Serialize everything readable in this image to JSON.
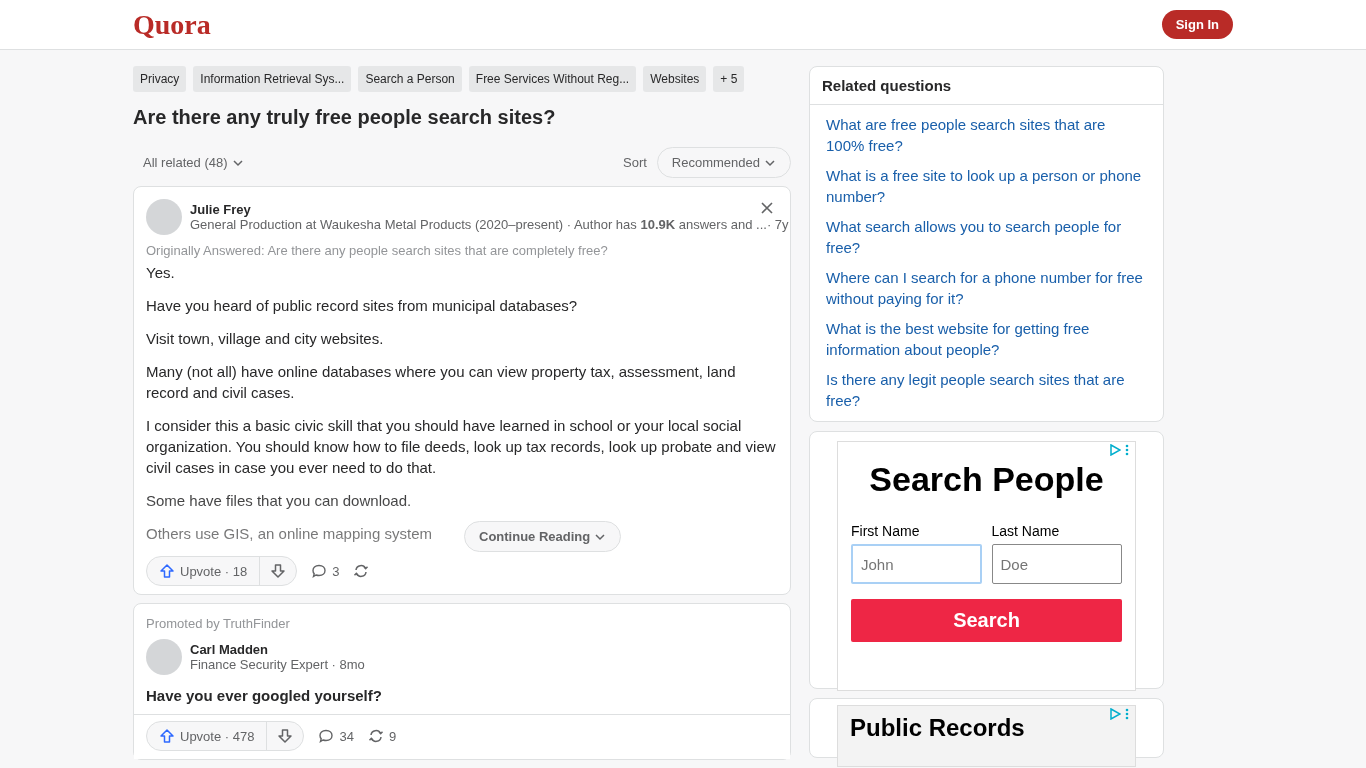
{
  "header": {
    "logo": "Quora",
    "sign_in": "Sign In"
  },
  "topics": [
    {
      "label": "Privacy"
    },
    {
      "label": "Information Retrieval Sys..."
    },
    {
      "label": "Search a Person"
    },
    {
      "label": "Free Services Without Reg..."
    },
    {
      "label": "Websites"
    }
  ],
  "more_topics": "+ 5",
  "question": "Are there any truly free people search sites?",
  "filter": {
    "label": "All related (48)",
    "sort_label": "Sort",
    "sort_value": "Recommended"
  },
  "answer": {
    "author": "Julie Frey",
    "meta": "General Production at Waukesha Metal Products (2020–present) · Author has **10.9K** answers and ...",
    "age": "· 7y",
    "original": "Originally Answered: Are there any people search sites that are completely free?",
    "paragraphs": [
      "Yes.",
      "Have you heard of public record sites from municipal databases?",
      "Visit town, village and city websites.",
      "Many (not all) have online databases where you can view property tax, assessment, land record and civil cases.",
      "I consider this a basic civic skill that you should have learned in school or your local social organization. You should know how to file deeds, look up tax records, look up probate and view civil cases in case you ever need to do that.",
      "Some have files that you can download.",
      "Others use GIS, an online mapping system"
    ],
    "continue": "Continue Reading",
    "upvote": "Upvote · 18",
    "comments": "3"
  },
  "promoted": {
    "label": "Promoted by TruthFinder",
    "author": "Carl Madden",
    "meta": "Finance Security Expert · 8mo",
    "headline": "Have you ever googled yourself?",
    "upvote": "Upvote · 478",
    "comments": "34",
    "shares": "9"
  },
  "related": {
    "title": "Related questions",
    "items": [
      "What are free people search sites that are 100% free?",
      "What is a free site to look up a person or phone number?",
      "What search allows you to search people for free?",
      "Where can I search for a phone number for free without paying for it?",
      "What is the best website for getting free information about people?",
      "Is there any legit people search sites that are free?"
    ]
  },
  "ad": {
    "title": "Search People",
    "first_label": "First Name",
    "first_placeholder": "John",
    "last_label": "Last Name",
    "last_placeholder": "Doe",
    "button": "Search"
  },
  "ad2": {
    "title": "Public Records"
  }
}
